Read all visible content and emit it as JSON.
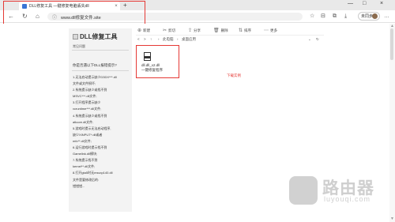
{
  "browser": {
    "tab": {
      "title": "DLL修复工具 —键修复电脑丢失dll",
      "close": "×"
    },
    "new_tab": "+",
    "window_controls": [
      "—",
      "□",
      "×"
    ],
    "nav": {
      "back": "←",
      "refresh": "↻",
      "home": "⌂"
    },
    "address": {
      "lock": "ⓘ",
      "url": "www.dll修复文件.site"
    },
    "profile": {
      "label": "未同步"
    },
    "menu": "…"
  },
  "dll_panel": {
    "title": "DLL修复工具",
    "subtitle": "常见问题",
    "question": "你是否遇以下DLL报错提示?",
    "items": [
      "1.无法启动提示缺少D3DX***.dll",
      "  文件或文件损坏;",
      "2.系统提示缺少或找不到",
      "  MSVC***.dll文件;",
      "3.打开程序提示缺少",
      "  vcruntime***.dll文件;",
      "4.系统提示缺少或找不到",
      "  atlcore.dll文件;",
      "5.游戏时提示无法启动程序,",
      "  缺少XINPUT*.dll或者",
      "  mfc**.dll文件;",
      "6.运行游戏时提示找不到",
      "  Gamelink.dll模块;",
      "7.系统提示找不到",
      "  kernel**.dll文件;",
      "8.打开gta5时无msvcp140.dll",
      "  文件是要修改后的:",
      "  错错错..."
    ]
  },
  "explorer": {
    "toolbar": [
      "新建",
      "剪切",
      "分享",
      "删除",
      "排序",
      "更多"
    ],
    "breadcrumb": [
      "<",
      ">",
      "↑",
      "›",
      "此电脑",
      "›",
      "桌面应用",
      "⌄"
    ],
    "refresh_icon": "↻",
    "file": {
      "name_line1": "dll.dll_x2.dll",
      "name_line2": "一键修复程序"
    },
    "download_label": "下载实例"
  },
  "watermark": {
    "text": "路由器",
    "url": "luyouqi.com"
  },
  "colors": {
    "highlight": "#e53935",
    "accent": "#3a75d6"
  }
}
